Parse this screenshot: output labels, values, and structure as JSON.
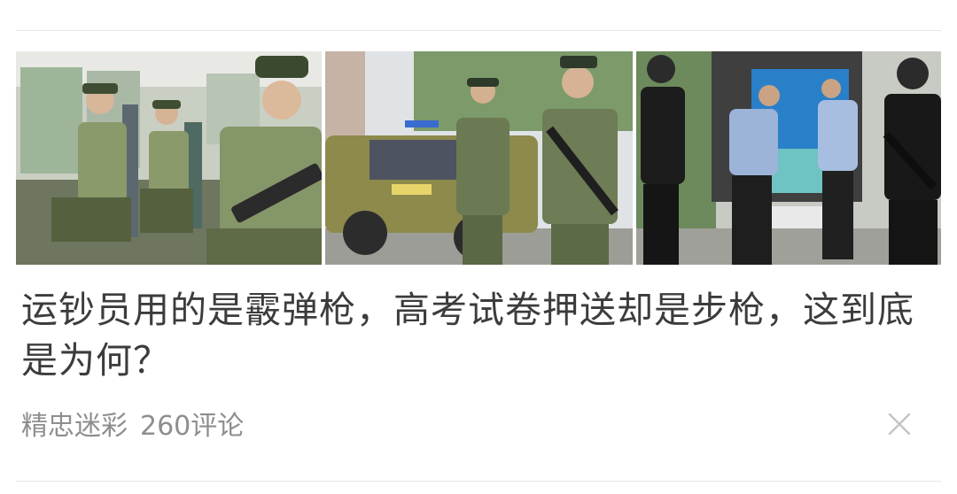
{
  "article": {
    "title": "运钞员用的是霰弹枪，高考试卷押送却是步枪，这到底是为何？",
    "source": "精忠迷彩",
    "comments": "260评论"
  },
  "images": [
    {
      "alt": "士兵在车内"
    },
    {
      "alt": "武警押运"
    },
    {
      "alt": "警察押运"
    }
  ],
  "icons": {
    "close": "close-icon"
  }
}
